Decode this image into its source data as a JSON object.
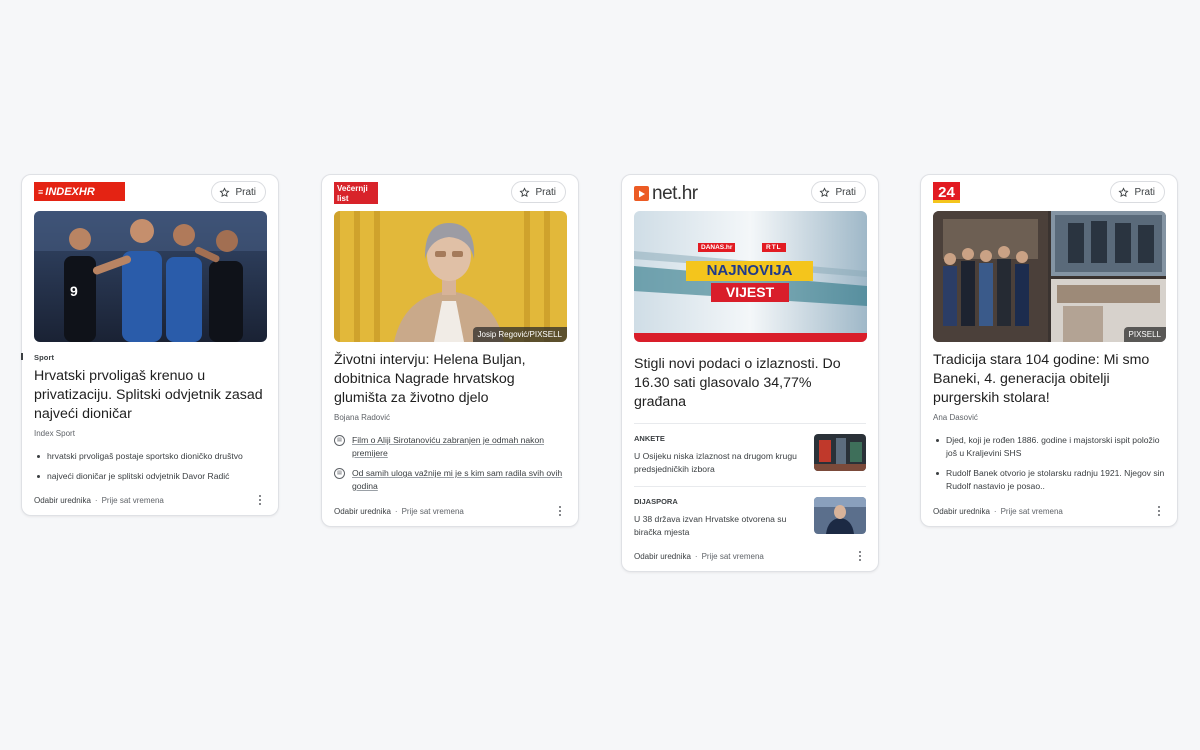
{
  "common": {
    "follow_label": "Prati",
    "editor_label": "Odabir urednika",
    "time_label": "Prije sat vremena"
  },
  "cards": [
    {
      "logo_text": "INDEXHR",
      "kicker": "Sport",
      "title": "Hrvatski prvoligaš krenuo u privatizaciju. Splitski odvjetnik zasad najveći dioničar",
      "source": "Index Sport",
      "bullets": [
        "hrvatski prvoligaš postaje sportsko dioničko društvo",
        "najveći dioničar je splitski odvjetnik Davor Radić"
      ]
    },
    {
      "logo_text_1": "Večernji",
      "logo_text_2": "list",
      "image_credit": "Josip Regović/PIXSELL",
      "title": "Životni intervju: Helena Buljan, dobitnica Nagrade hrvatskog glumišta za životno djelo",
      "source": "Bojana Radović",
      "links": [
        "Film o Aliji Sirotanoviću zabranjen je odmah nakon premijere",
        "Od samih uloga važnije mi je s kim sam radila svih ovih godina"
      ]
    },
    {
      "logo_text": "net.hr",
      "image_brand_1": "DANAS.hr",
      "image_brand_2": "RTL",
      "image_line_1": "NAJNOVIJA",
      "image_line_2": "VIJEST",
      "title": "Stigli novi podaci o izlaznosti. Do 16.30 sati glasovalo 34,77% građana",
      "subs": [
        {
          "category": "ANKETE",
          "text": "U Osijeku niska izlaznost na drugom krugu predsjedničkih izbora"
        },
        {
          "category": "DIJASPORA",
          "text": "U 38 država izvan Hrvatske otvorena su biračka mjesta"
        }
      ]
    },
    {
      "logo_text": "24",
      "image_credit": "PIXSELL",
      "title": "Tradicija stara 104 godine: Mi smo Baneki, 4. generacija obitelji purgerskih stolara!",
      "source": "Ana Dasović",
      "bullets": [
        "Djed, koji je rođen 1886. godine i majstorski ispit položio još u Kraljevini SHS",
        "Rudolf Banek otvorio je stolarsku radnju 1921. Njegov sin Rudolf nastavio je posao.."
      ]
    }
  ],
  "colors": {
    "index_red": "#e42313",
    "vecernji_red": "#d8232a",
    "net_orange": "#ec5b24",
    "background": "#f6f7f9"
  }
}
